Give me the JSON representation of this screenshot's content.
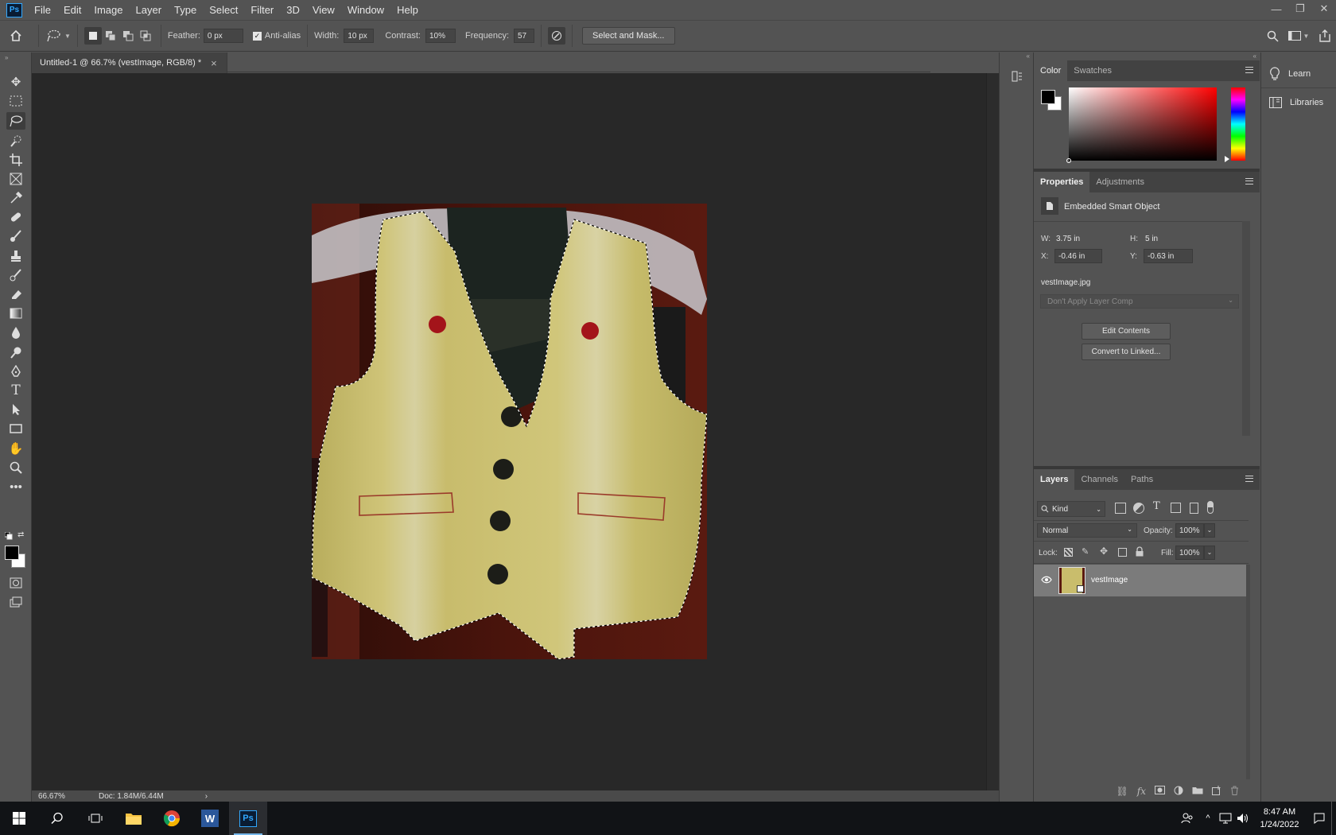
{
  "app": {
    "logo": "Ps"
  },
  "menu": [
    "File",
    "Edit",
    "Image",
    "Layer",
    "Type",
    "Select",
    "Filter",
    "3D",
    "View",
    "Window",
    "Help"
  ],
  "options": {
    "feather_label": "Feather:",
    "feather_value": "0 px",
    "antialias_label": "Anti-alias",
    "antialias_checked": true,
    "width_label": "Width:",
    "width_value": "10 px",
    "contrast_label": "Contrast:",
    "contrast_value": "10%",
    "frequency_label": "Frequency:",
    "frequency_value": "57",
    "select_mask_label": "Select and Mask..."
  },
  "document": {
    "tab_title": "Untitled-1 @ 66.7% (vestImage, RGB/8) *",
    "close_glyph": "×",
    "zoom": "66.67%",
    "doc_info": "Doc: 1.84M/6.44M",
    "status_arrow": "›"
  },
  "color_panel": {
    "tabs": [
      "Color",
      "Swatches"
    ],
    "active": "Color",
    "hue_color": "#ff0000"
  },
  "properties_panel": {
    "tabs": [
      "Properties",
      "Adjustments"
    ],
    "active": "Properties",
    "type_label": "Embedded Smart Object",
    "w_label": "W:",
    "w_value": "3.75 in",
    "h_label": "H:",
    "h_value": "5 in",
    "x_label": "X:",
    "x_value": "-0.46 in",
    "y_label": "Y:",
    "y_value": "-0.63 in",
    "filename": "vestImage.jpg",
    "layer_comp": "Don't Apply Layer Comp",
    "edit_contents": "Edit Contents",
    "convert_linked": "Convert to Linked..."
  },
  "layers_panel": {
    "tabs": [
      "Layers",
      "Channels",
      "Paths"
    ],
    "active": "Layers",
    "kind_label": "Kind",
    "blend_mode": "Normal",
    "opacity_label": "Opacity:",
    "opacity_value": "100%",
    "lock_label": "Lock:",
    "fill_label": "Fill:",
    "fill_value": "100%",
    "layers": [
      {
        "name": "vestImage",
        "visible": true
      }
    ]
  },
  "side_panel": {
    "learn": "Learn",
    "libraries": "Libraries"
  },
  "taskbar": {
    "time": "8:47 AM",
    "date": "1/24/2022"
  }
}
